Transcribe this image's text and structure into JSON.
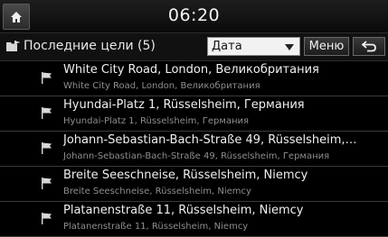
{
  "status": {
    "time": "06:20",
    "home_icon": "home-icon"
  },
  "toolbar": {
    "title": "Последние цели (5)",
    "sort_value": "Дата",
    "menu_label": "Меню",
    "back_icon": "back-arrow-icon"
  },
  "destinations": [
    {
      "title": "White City Road, London, Великобритания",
      "subtitle": "White City Road, London, Великобритания"
    },
    {
      "title": "Hyundai-Platz 1, Rüsselsheim, Германия",
      "subtitle": "Hyundai-Platz 1, Rüsselsheim, Германия"
    },
    {
      "title": "Johann-Sebastian-Bach-Straße 49, Rüsselsheim,…",
      "subtitle": "Johann-Sebastian-Bach-Straße 49, Rüsselsheim, Германия"
    },
    {
      "title": "Breite Seeschneise, Rüsselsheim, Niemcy",
      "subtitle": "Breite Seeschneise, Rüsselsheim, Niemcy"
    },
    {
      "title": "Platanenstraße 11, Rüsselsheim, Niemcy",
      "subtitle": "Platanenstraße 11, Rüsselsheim, Niemcy"
    }
  ]
}
